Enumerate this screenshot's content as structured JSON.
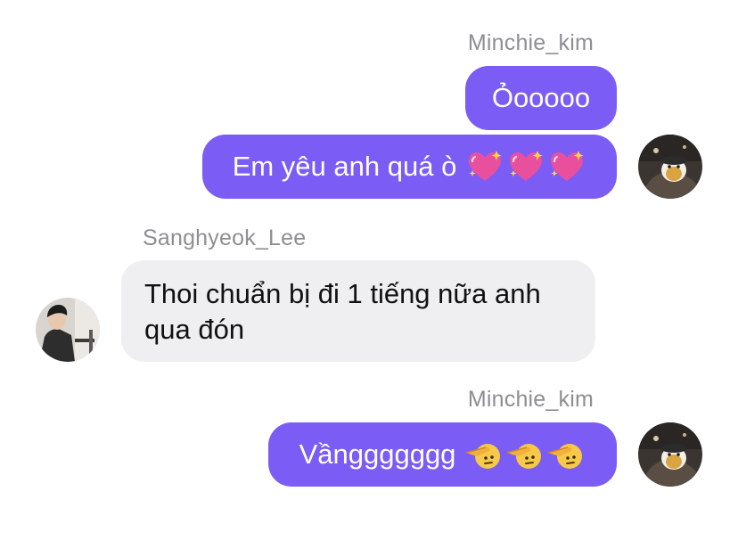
{
  "messages": [
    {
      "sender": "Minchie_kim",
      "text": "Ỏooooo"
    },
    {
      "text": "Em yêu anh quá ò",
      "emojis": [
        "sparkling-heart",
        "sparkling-heart",
        "sparkling-heart"
      ]
    },
    {
      "sender": "Sanghyeok_Lee",
      "text_line1": "Thoi chuẩn bị đi 1 tiếng nữa anh",
      "text_line2": "qua đón"
    },
    {
      "sender": "Minchie_kim",
      "text": "Vầnggggggg",
      "emojis": [
        "saluting-face",
        "saluting-face",
        "saluting-face"
      ]
    }
  ],
  "colors": {
    "outgoing_bubble": "#7b5cf5",
    "incoming_bubble": "#efeff2",
    "sender_name": "#8e8e93",
    "background": "#ffffff"
  }
}
